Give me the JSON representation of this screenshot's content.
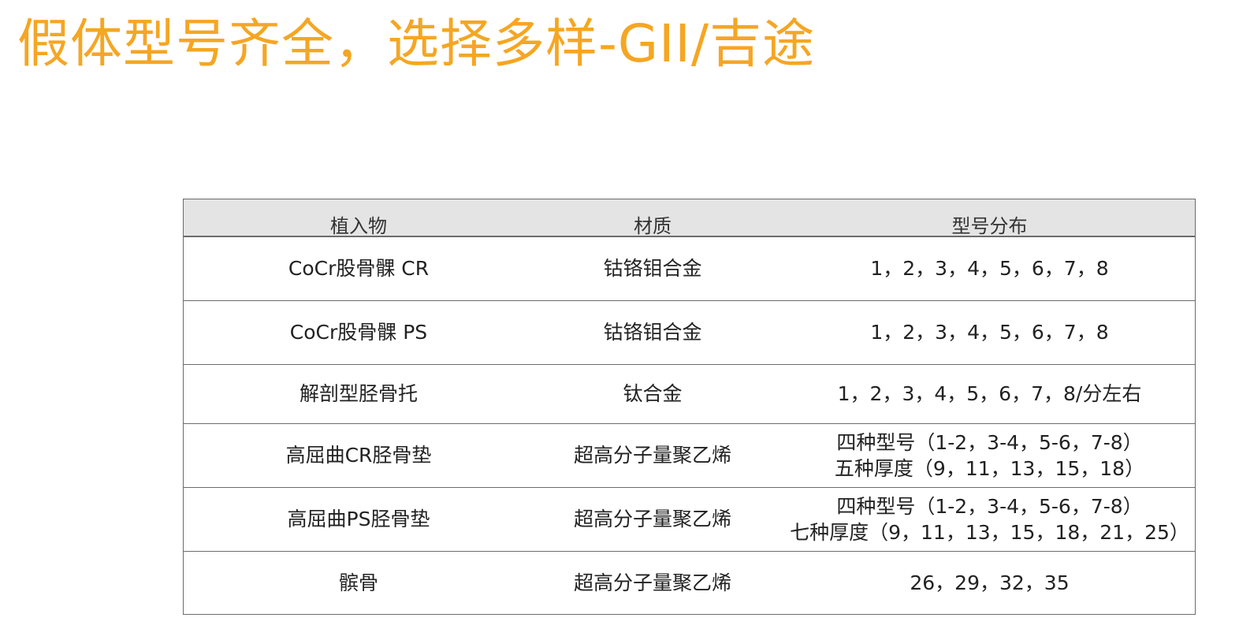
{
  "title": "假体型号齐全，选择多样-GII/吉途",
  "table": {
    "headers": [
      "植入物",
      "材质",
      "型号分布"
    ],
    "rows": [
      {
        "implant": "CoCr股骨髁 CR",
        "material": "钴铬钼合金",
        "sizes": [
          "1，2，3，4，5，6，7，8"
        ]
      },
      {
        "implant": "CoCr股骨髁 PS",
        "material": "钴铬钼合金",
        "sizes": [
          "1，2，3，4，5，6，7，8"
        ]
      },
      {
        "implant": "解剖型胫骨托",
        "material": "钛合金",
        "sizes": [
          "1，2，3，4，5，6，7，8/分左右"
        ]
      },
      {
        "implant": "高屈曲CR胫骨垫",
        "material": "超高分子量聚乙烯",
        "sizes": [
          "四种型号（1-2，3-4，5-6，7-8）",
          "五种厚度（9，11，13，15，18）"
        ]
      },
      {
        "implant": "高屈曲PS胫骨垫",
        "material": "超高分子量聚乙烯",
        "sizes": [
          "四种型号（1-2，3-4，5-6，7-8）",
          "七种厚度（9，11，13，15，18，21，25）"
        ]
      },
      {
        "implant": "髌骨",
        "material": "超高分子量聚乙烯",
        "sizes": [
          "26，29，32，35"
        ]
      }
    ]
  },
  "colors": {
    "title": "#f5a623",
    "header_bg": "#e4e4e4",
    "border": "#6b6b6b"
  }
}
